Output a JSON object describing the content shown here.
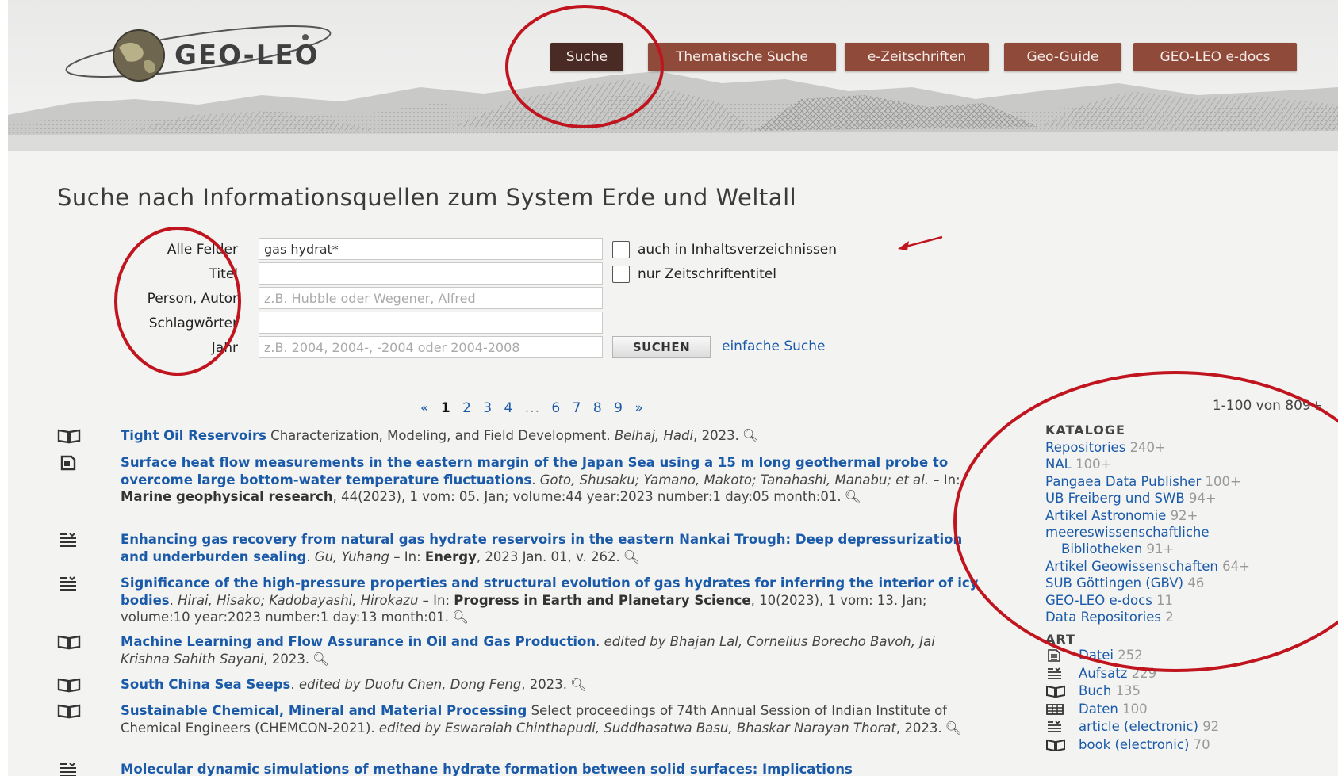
{
  "header": {
    "logo_text": "GEO-LEO",
    "nav": [
      {
        "label": "Suche",
        "active": true
      },
      {
        "label": "Thematische Suche",
        "active": false
      },
      {
        "label": "e-Zeitschriften",
        "active": false
      },
      {
        "label": "Geo-Guide",
        "active": false
      },
      {
        "label": "GEO-LEO e-docs",
        "active": false
      }
    ]
  },
  "page_title": "Suche nach Informationsquellen zum System Erde und Weltall",
  "form": {
    "fields": [
      {
        "label": "Alle Felder",
        "value": "gas hydrat*",
        "placeholder": ""
      },
      {
        "label": "Titel",
        "value": "",
        "placeholder": ""
      },
      {
        "label": "Person, Autor",
        "value": "",
        "placeholder": "z.B. Hubble oder Wegener, Alfred"
      },
      {
        "label": "Schlagwörter",
        "value": "",
        "placeholder": ""
      },
      {
        "label": "Jahr",
        "value": "",
        "placeholder": "z.B. 2004, 2004-, -2004 oder 2004-2008"
      }
    ],
    "checkbox_toc": "auch in Inhaltsverzeichnissen",
    "checkbox_journal": "nur Zeitschriftentitel",
    "submit_label": "SUCHEN",
    "simple_search_link": "einfache Suche"
  },
  "pagination": {
    "prev": "«",
    "pages_a": [
      "1",
      "2",
      "3",
      "4"
    ],
    "ellipsis": "...",
    "pages_b": [
      "6",
      "7",
      "8",
      "9"
    ],
    "next": "»",
    "current": "1"
  },
  "result_count": "1-100 von 809+",
  "results": [
    {
      "icon": "book-icon",
      "title": "Tight Oil Reservoirs",
      "rest": " Characterization, Modeling, and Field Development. ",
      "authors": "Belhaj, Hadi",
      "tail": ", 2023."
    },
    {
      "icon": "journal-article-icon",
      "title": "Surface heat flow measurements in the eastern margin of the Japan Sea using a 15 m long geothermal probe to overcome large bottom-water temperature fluctuations",
      "rest": ". ",
      "authors": "Goto, Shusaku; Yamano, Makoto; Tanahashi, Manabu; et al.",
      "in_prefix": " – In: ",
      "source": "Marine geophysical research",
      "tail": ", 44(2023), 1 vom: 05. Jan; volume:44 year:2023 number:1 day:05 month:01."
    },
    {
      "icon": "article-icon",
      "title": "Enhancing gas recovery from natural gas hydrate reservoirs in the eastern Nankai Trough: Deep depressurization and underburden sealing",
      "rest": ". ",
      "authors": "Gu, Yuhang",
      "in_prefix": " – In: ",
      "source": "Energy",
      "tail": ", 2023 Jan. 01, v. 262."
    },
    {
      "icon": "article-icon",
      "title": "Significance of the high-pressure properties and structural evolution of gas hydrates for inferring the interior of icy bodies",
      "rest": ". ",
      "authors": "Hirai, Hisako; Kadobayashi, Hirokazu",
      "in_prefix": " – In: ",
      "source": "Progress in Earth and Planetary Science",
      "tail": ", 10(2023), 1 vom: 13. Jan; volume:10 year:2023 number:1 day:13 month:01."
    },
    {
      "icon": "book-icon",
      "title": "Machine Learning and Flow Assurance in Oil and Gas Production",
      "rest": ". ",
      "authors": "edited by Bhajan Lal, Cornelius Borecho Bavoh, Jai Krishna Sahith Sayani",
      "tail": ", 2023."
    },
    {
      "icon": "book-icon",
      "title": "South China Sea Seeps",
      "rest": ". ",
      "authors": "edited by Duofu Chen, Dong Feng",
      "tail": ", 2023."
    },
    {
      "icon": "book-icon",
      "title": "Sustainable Chemical, Mineral and Material Processing",
      "rest": " Select proceedings of 74th Annual Session of Indian Institute of Chemical Engineers (CHEMCON-2021). ",
      "authors": "edited by Eswaraiah Chinthapudi, Suddhasatwa Basu, Bhaskar Narayan Thorat",
      "tail": ", 2023."
    },
    {
      "icon": "article-icon",
      "title": "Molecular dynamic simulations of methane hydrate formation between solid surfaces: Implications",
      "rest": "",
      "authors": "",
      "tail": ""
    }
  ],
  "sidebar": {
    "kataloge_heading": "KATALOGE",
    "kataloge": [
      {
        "label": "Repositories",
        "count": "240+"
      },
      {
        "label": "NAL",
        "count": "100+"
      },
      {
        "label": "Pangaea Data Publisher",
        "count": "100+"
      },
      {
        "label": "UB Freiberg und SWB",
        "count": "94+"
      },
      {
        "label": "Artikel Astronomie",
        "count": "92+"
      },
      {
        "label": "meereswissenschaftliche",
        "count": ""
      },
      {
        "label": "Bibliotheken",
        "count": "91+"
      },
      {
        "label": "Artikel Geowissenschaften",
        "count": "64+"
      },
      {
        "label": "SUB Göttingen (GBV)",
        "count": "46"
      },
      {
        "label": "GEO-LEO e-docs",
        "count": "11"
      },
      {
        "label": "Data Repositories",
        "count": "2"
      }
    ],
    "art_heading": "ART",
    "art": [
      {
        "icon": "file-icon",
        "label": "Datei",
        "count": "252"
      },
      {
        "icon": "article-icon",
        "label": "Aufsatz",
        "count": "229"
      },
      {
        "icon": "book-icon",
        "label": "Buch",
        "count": "135"
      },
      {
        "icon": "table-icon",
        "label": "Daten",
        "count": "100"
      },
      {
        "icon": "article-icon",
        "label": "article (electronic)",
        "count": "92"
      },
      {
        "icon": "book-icon",
        "label": "book (electronic)",
        "count": "70"
      }
    ]
  },
  "annotation_color": "#c0141e",
  "brand_color": "#8f4a3a",
  "link_color": "#1a5aa8"
}
